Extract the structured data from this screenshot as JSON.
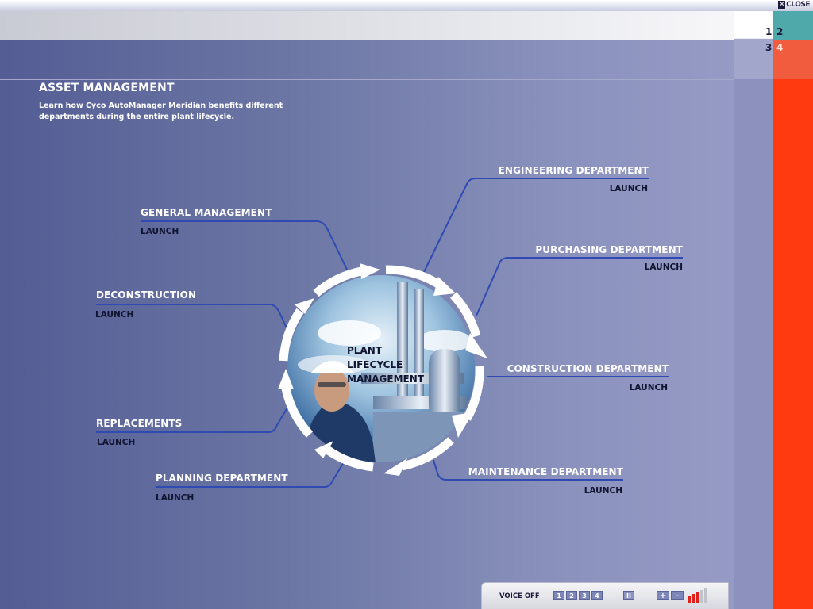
{
  "window": {
    "close_label": "CLOSE"
  },
  "pager": {
    "p1": "1",
    "p2": "2",
    "p3": "3",
    "p4": "4"
  },
  "header": {
    "title": "ASSET MANAGEMENT",
    "subtitle": "Learn how Cyco AutoManager Meridian benefits different departments during the entire plant lifecycle."
  },
  "center": {
    "line1": "PLANT",
    "line2": "LIFECYCLE",
    "line3": "MANAGEMENT"
  },
  "departments": {
    "general": {
      "name": "GENERAL MANAGEMENT",
      "launch": "LAUNCH"
    },
    "deconstruction": {
      "name": "DECONSTRUCTION",
      "launch": "LAUNCH"
    },
    "replacements": {
      "name": "REPLACEMENTS",
      "launch": "LAUNCH"
    },
    "planning": {
      "name": "PLANNING DEPARTMENT",
      "launch": "LAUNCH"
    },
    "engineering": {
      "name": "ENGINEERING DEPARTMENT",
      "launch": "LAUNCH"
    },
    "purchasing": {
      "name": "PURCHASING DEPARTMENT",
      "launch": "LAUNCH"
    },
    "construction": {
      "name": "CONSTRUCTION DEPARTMENT",
      "launch": "LAUNCH"
    },
    "maintenance": {
      "name": "MAINTENANCE DEPARTMENT",
      "launch": "LAUNCH"
    }
  },
  "controls": {
    "voice": "VOICE OFF",
    "pages": [
      "1",
      "2",
      "3",
      "4"
    ],
    "pause": "II",
    "vol_up": "+",
    "vol_down": "–"
  },
  "colors": {
    "accent_red": "#ff3a10",
    "teal": "#4fa8a9",
    "line_blue": "#2f4bb3"
  }
}
